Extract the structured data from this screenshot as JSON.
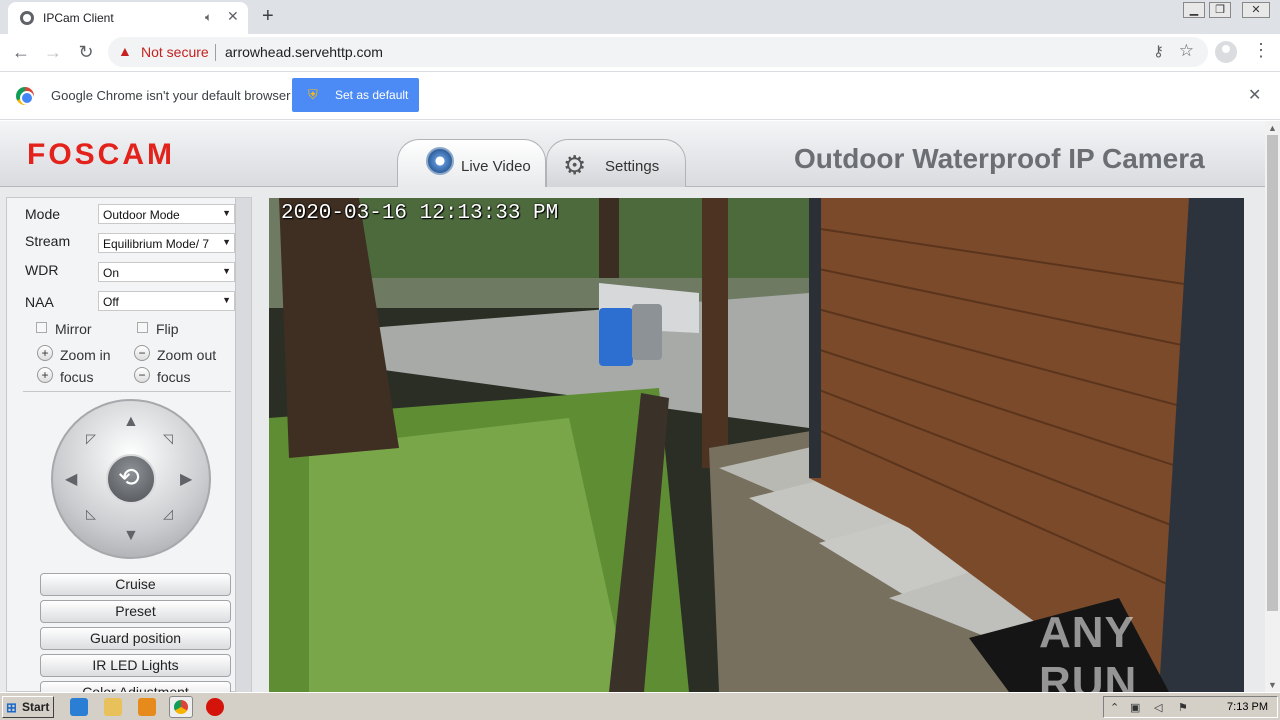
{
  "browser": {
    "tab": {
      "title": "IPCam Client",
      "audio_icon": "speaker-icon",
      "close_glyph": "✕"
    },
    "new_tab_glyph": "+",
    "window_controls": [
      "minimize",
      "restore",
      "close"
    ],
    "toolbar": {
      "back_icon": "←",
      "forward_icon": "→",
      "reload_icon": "↻",
      "security_label": "Not secure",
      "url": "arrowhead.servehttp.com"
    },
    "infobar": {
      "message": "Google Chrome isn't your default browser",
      "button_label": "Set as default",
      "close_glyph": "✕"
    }
  },
  "app": {
    "logo": "FOSCAM",
    "tabs": [
      {
        "label": "Live Video",
        "icon": "camera-icon",
        "active": true
      },
      {
        "label": "Settings",
        "icon": "gear-icon",
        "active": false
      }
    ],
    "title": "Outdoor Waterproof IP Camera"
  },
  "sidebar": {
    "settings": [
      {
        "label": "Mode",
        "value": "Outdoor Mode"
      },
      {
        "label": "Stream",
        "value": "Equilibrium Mode/ 7"
      },
      {
        "label": "WDR",
        "value": "On"
      },
      {
        "label": "NAA",
        "value": "Off"
      }
    ],
    "checkboxes": [
      {
        "label": "Mirror",
        "checked": false
      },
      {
        "label": "Flip",
        "checked": false
      }
    ],
    "zoom_in": "Zoom in",
    "zoom_out": "Zoom out",
    "focus_plus": "focus",
    "focus_minus": "focus",
    "buttons": [
      "Cruise",
      "Preset",
      "Guard position",
      "IR LED Lights",
      "Color Adjustment"
    ]
  },
  "video": {
    "timestamp": "2020-03-16 12:13:33 PM",
    "watermark": "ANY RUN"
  },
  "taskbar": {
    "start_label": "Start",
    "apps": [
      "internet-explorer-icon",
      "folder-icon",
      "media-player-icon",
      "chrome-icon",
      "stop-icon"
    ],
    "time": "7:13 PM"
  },
  "colors": {
    "foscam_red": "#e3221b",
    "chrome_blue": "#4c8bf5",
    "insecure_red": "#c5221f"
  }
}
